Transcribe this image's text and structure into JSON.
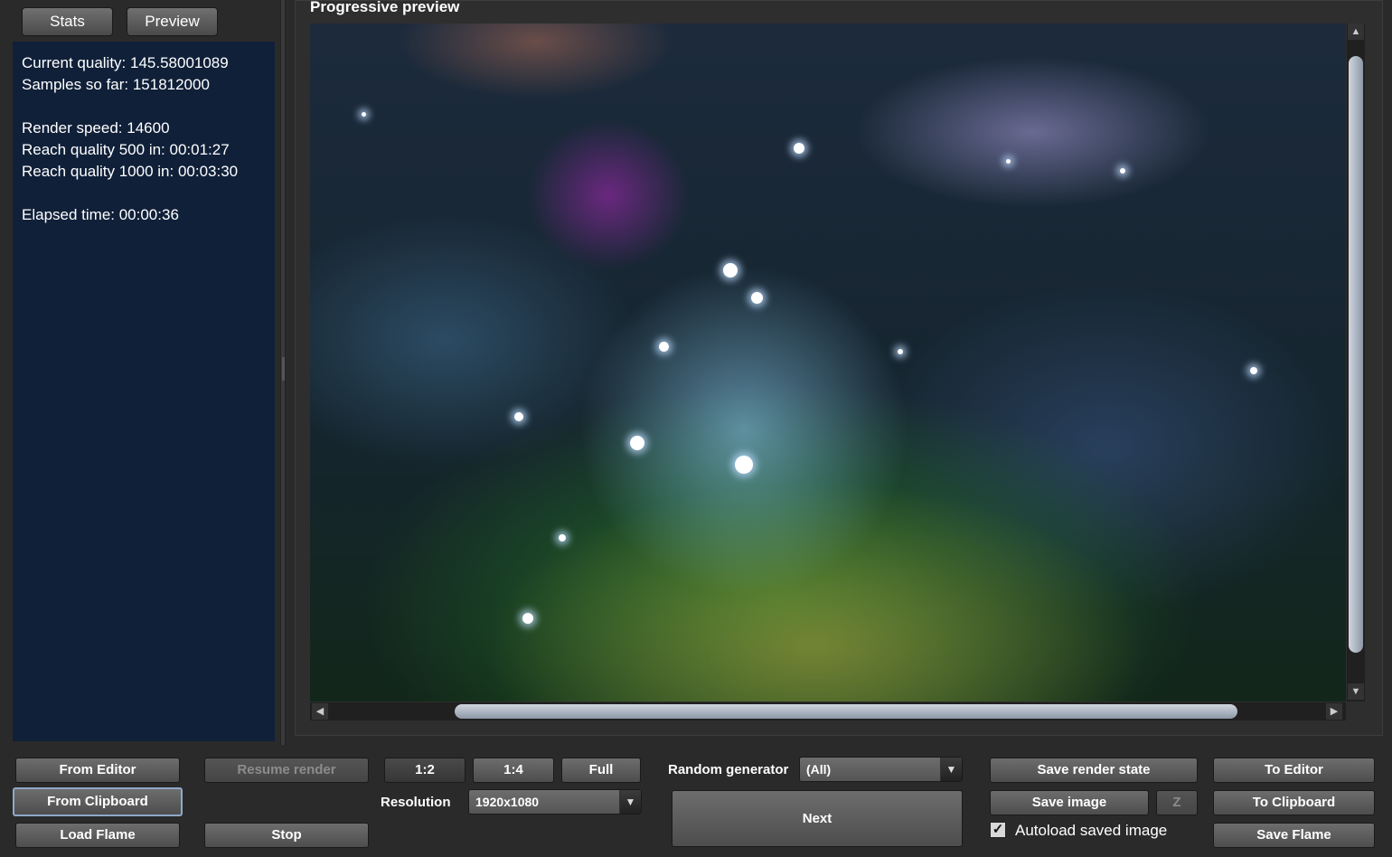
{
  "left_tabs": {
    "stats": "Stats",
    "preview": "Preview"
  },
  "stats": {
    "current_quality": "Current quality: 145.58001089",
    "samples": "Samples so far: 151812000",
    "render_speed": "Render speed: 14600",
    "reach_500": "Reach quality 500 in: 00:01:27",
    "reach_1000": "Reach quality 1000 in: 00:03:30",
    "elapsed": "Elapsed time: 00:00:36"
  },
  "preview": {
    "title": "Progressive preview"
  },
  "buttons": {
    "from_editor": "From Editor",
    "from_clipboard": "From Clipboard",
    "load_flame": "Load Flame",
    "resume_render": "Resume render",
    "stop": "Stop",
    "ratio_1_2": "1:2",
    "ratio_1_4": "1:4",
    "full": "Full",
    "next": "Next",
    "save_render_state": "Save render state",
    "save_image": "Save image",
    "z": "Z",
    "to_editor": "To Editor",
    "to_clipboard": "To Clipboard",
    "save_flame": "Save Flame"
  },
  "resolution": {
    "label": "Resolution",
    "value": "1920x1080"
  },
  "random_generator": {
    "label": "Random generator",
    "value": "(All)"
  },
  "autoload": {
    "label": "Autoload saved image",
    "checked": true,
    "mark": "✓"
  },
  "icons": {
    "scroll_up": "▲",
    "scroll_down": "▼",
    "scroll_left": "◀",
    "scroll_right": "▶",
    "dropdown": "▼"
  }
}
